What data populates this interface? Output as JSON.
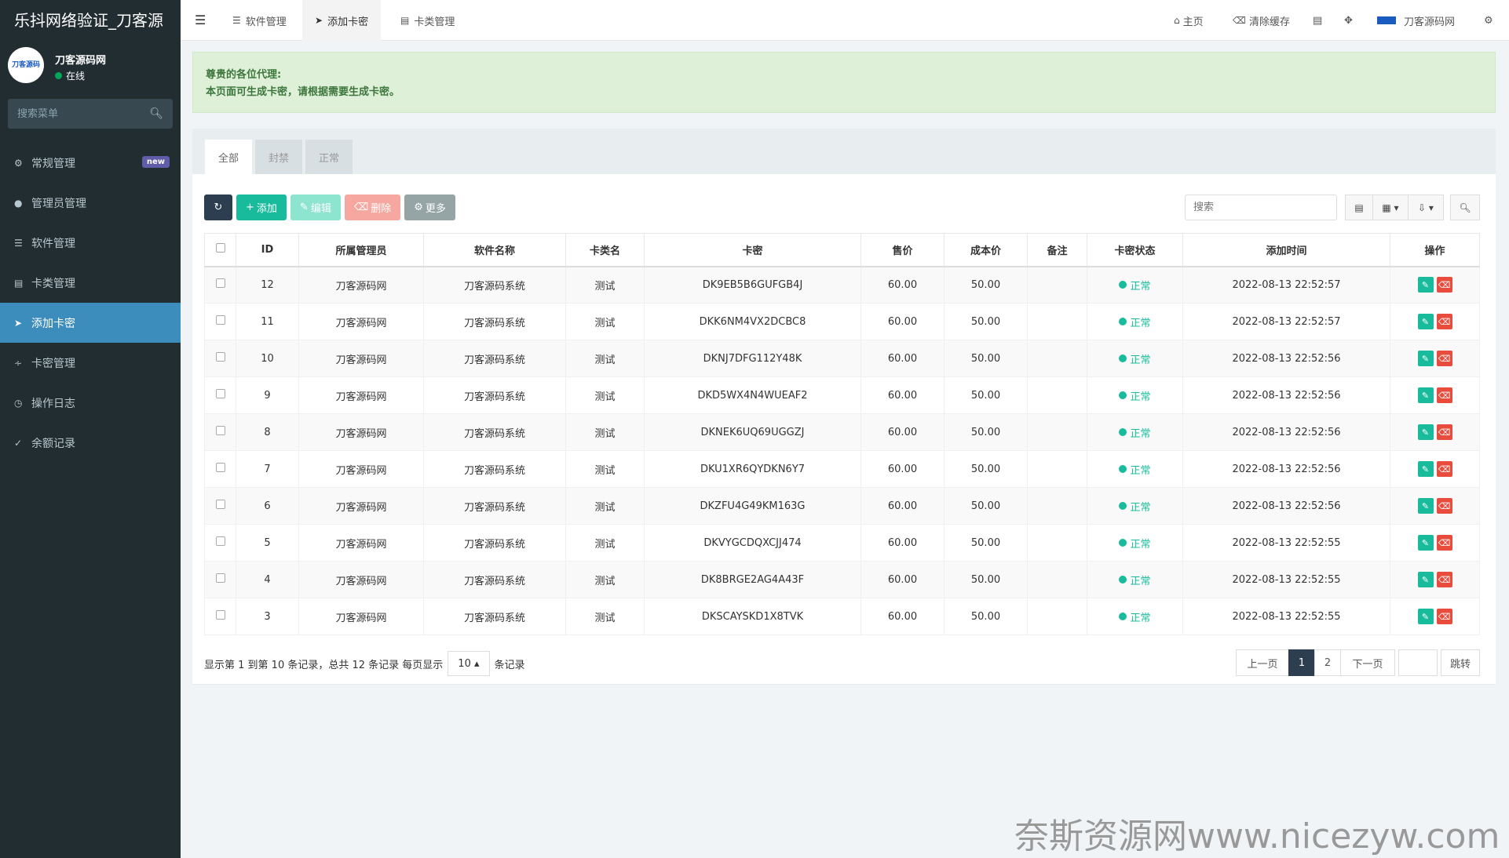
{
  "app": {
    "title": "乐抖网络验证_刀客源"
  },
  "user": {
    "avatar_text": "刀客源码",
    "name": "刀客源码网",
    "status": "在线"
  },
  "sidebar": {
    "search_placeholder": "搜索菜单",
    "items": [
      {
        "label": "常规管理",
        "badge": "new"
      },
      {
        "label": "管理员管理"
      },
      {
        "label": "软件管理"
      },
      {
        "label": "卡类管理"
      },
      {
        "label": "添加卡密"
      },
      {
        "label": "卡密管理"
      },
      {
        "label": "操作日志"
      },
      {
        "label": "余额记录"
      }
    ]
  },
  "topbar": {
    "tabs": [
      "软件管理",
      "添加卡密",
      "卡类管理"
    ],
    "home": "主页",
    "clear_cache": "清除缓存",
    "account": "刀客源码网"
  },
  "alert": {
    "line1": "尊贵的各位代理:",
    "line2": "本页面可生成卡密，请根据需要生成卡密。"
  },
  "panel_tabs": [
    "全部",
    "封禁",
    "正常"
  ],
  "toolbar": {
    "add": "添加",
    "edit": "编辑",
    "delete": "删除",
    "more": "更多",
    "search_placeholder": "搜索"
  },
  "table": {
    "headers": [
      "ID",
      "所属管理员",
      "软件名称",
      "卡类名",
      "卡密",
      "售价",
      "成本价",
      "备注",
      "卡密状态",
      "添加时间",
      "操作"
    ],
    "rows": [
      {
        "id": "12",
        "admin": "刀客源码网",
        "software": "刀客源码系统",
        "type": "测试",
        "card": "DK9EB5B6GUFGB4J",
        "price": "60.00",
        "cost": "50.00",
        "note": "",
        "status": "正常",
        "time": "2022-08-13 22:52:57"
      },
      {
        "id": "11",
        "admin": "刀客源码网",
        "software": "刀客源码系统",
        "type": "测试",
        "card": "DKK6NM4VX2DCBC8",
        "price": "60.00",
        "cost": "50.00",
        "note": "",
        "status": "正常",
        "time": "2022-08-13 22:52:57"
      },
      {
        "id": "10",
        "admin": "刀客源码网",
        "software": "刀客源码系统",
        "type": "测试",
        "card": "DKNJ7DFG112Y48K",
        "price": "60.00",
        "cost": "50.00",
        "note": "",
        "status": "正常",
        "time": "2022-08-13 22:52:56"
      },
      {
        "id": "9",
        "admin": "刀客源码网",
        "software": "刀客源码系统",
        "type": "测试",
        "card": "DKD5WX4N4WUEAF2",
        "price": "60.00",
        "cost": "50.00",
        "note": "",
        "status": "正常",
        "time": "2022-08-13 22:52:56"
      },
      {
        "id": "8",
        "admin": "刀客源码网",
        "software": "刀客源码系统",
        "type": "测试",
        "card": "DKNEK6UQ69UGGZJ",
        "price": "60.00",
        "cost": "50.00",
        "note": "",
        "status": "正常",
        "time": "2022-08-13 22:52:56"
      },
      {
        "id": "7",
        "admin": "刀客源码网",
        "software": "刀客源码系统",
        "type": "测试",
        "card": "DKU1XR6QYDKN6Y7",
        "price": "60.00",
        "cost": "50.00",
        "note": "",
        "status": "正常",
        "time": "2022-08-13 22:52:56"
      },
      {
        "id": "6",
        "admin": "刀客源码网",
        "software": "刀客源码系统",
        "type": "测试",
        "card": "DKZFU4G49KM163G",
        "price": "60.00",
        "cost": "50.00",
        "note": "",
        "status": "正常",
        "time": "2022-08-13 22:52:56"
      },
      {
        "id": "5",
        "admin": "刀客源码网",
        "software": "刀客源码系统",
        "type": "测试",
        "card": "DKVYGCDQXCJJ474",
        "price": "60.00",
        "cost": "50.00",
        "note": "",
        "status": "正常",
        "time": "2022-08-13 22:52:55"
      },
      {
        "id": "4",
        "admin": "刀客源码网",
        "software": "刀客源码系统",
        "type": "测试",
        "card": "DK8BRGE2AG4A43F",
        "price": "60.00",
        "cost": "50.00",
        "note": "",
        "status": "正常",
        "time": "2022-08-13 22:52:55"
      },
      {
        "id": "3",
        "admin": "刀客源码网",
        "software": "刀客源码系统",
        "type": "测试",
        "card": "DKSCAYSKD1X8TVK",
        "price": "60.00",
        "cost": "50.00",
        "note": "",
        "status": "正常",
        "time": "2022-08-13 22:52:55"
      }
    ]
  },
  "footer": {
    "summary": "显示第 1 到第 10 条记录，总共 12 条记录 每页显示",
    "page_size": "10",
    "suffix": "条记录"
  },
  "pager": {
    "prev": "上一页",
    "pages": [
      "1",
      "2"
    ],
    "next": "下一页",
    "jump": "跳转"
  },
  "watermark": "奈斯资源网www.nicezyw.com",
  "colors": {
    "sidebar": "#222d32",
    "active": "#3c8dbc",
    "success": "#18bc9c",
    "danger": "#e74c3c",
    "alert_bg": "#dff0d8"
  }
}
